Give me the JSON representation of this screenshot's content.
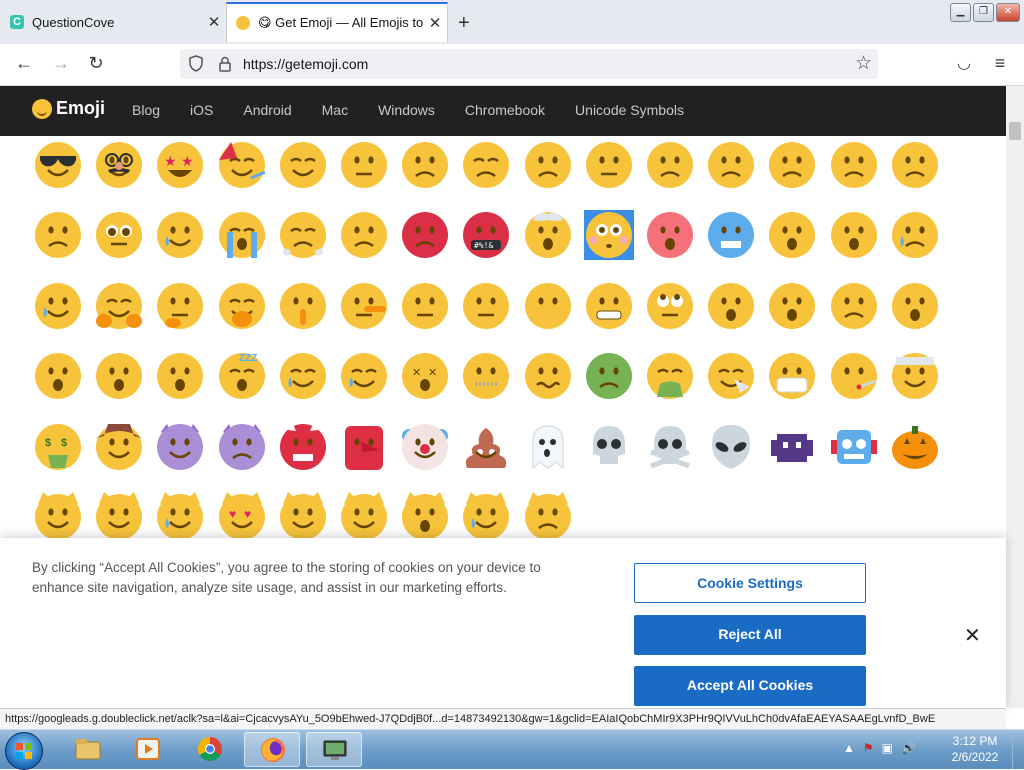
{
  "browser": {
    "tabs": [
      {
        "title": "QuestionCove",
        "active": false
      },
      {
        "title": "😋 Get Emoji — All Emojis to ✂️",
        "active": true
      }
    ],
    "url": "https://getemoji.com"
  },
  "site": {
    "brand": "Emoji",
    "nav": [
      "Blog",
      "iOS",
      "Android",
      "Mac",
      "Windows",
      "Chromebook",
      "Unicode Symbols"
    ]
  },
  "emoji_grid": {
    "selected_row": 1,
    "selected_col": 9,
    "rows": [
      [
        "sunglasses-face",
        "disguised-face",
        "star-struck",
        "partying-face",
        "smirking-face",
        "unamused-face",
        "disappointed-face",
        "pensive-face",
        "worried-face",
        "confused-face",
        "slightly-frowning-face",
        "frowning-face",
        "persevering-face",
        "confounded-face",
        "tired-face"
      ],
      [
        "weary-face",
        "pleading-face",
        "crying-face",
        "loudly-crying-face",
        "face-with-steam",
        "angry-face",
        "pouting-face",
        "face-with-symbols",
        "exploding-head",
        "flushed-face",
        "hot-face",
        "cold-face",
        "screaming-face",
        "anxious-face",
        "sad-sweat-face"
      ],
      [
        "downcast-sweat-face",
        "hugging-face",
        "thinking-face",
        "face-hand-over-mouth",
        "shushing-face",
        "lying-face",
        "neutral-face",
        "expressionless-face",
        "no-mouth-face",
        "grimacing-face",
        "rolling-eyes-face",
        "hushed-face",
        "frowning-open-mouth",
        "anguished-face",
        "fearful-face"
      ],
      [
        "open-mouth-face",
        "astonished-face",
        "yawning-face",
        "sleeping-face",
        "drooling-face",
        "sleepy-face",
        "dizzy-face",
        "zipper-mouth-face",
        "woozy-face",
        "nauseated-face",
        "vomiting-face",
        "sneezing-face",
        "mask-face",
        "thermometer-face",
        "bandage-face"
      ],
      [
        "money-mouth-face",
        "cowboy-face",
        "smiling-devil",
        "angry-devil",
        "ogre",
        "goblin",
        "clown-face",
        "pile-of-poo",
        "ghost",
        "skull",
        "skull-crossbones",
        "alien",
        "alien-monster",
        "robot",
        "jack-o-lantern"
      ],
      [
        "grinning-cat",
        "grinning-cat-smiling-eyes",
        "cat-tears-of-joy",
        "heart-eyes-cat",
        "wry-smile-cat",
        "kissing-cat",
        "weary-cat",
        "crying-cat",
        "pouting-cat"
      ]
    ]
  },
  "cookie_banner": {
    "text": "By clicking “Accept All Cookies”, you agree to the storing of cookies on your device to enhance site navigation, analyze site usage, and assist in our marketing efforts.",
    "settings_label": "Cookie Settings",
    "reject_label": "Reject All",
    "accept_label": "Accept All Cookies",
    "close_label": "✕"
  },
  "status_bar": {
    "text": "https://googleads.g.doubleclick.net/aclk?sa=l&ai=CjcacvysAYu_5O9bEhwed-J7QDdjB0f...d=14873492130&gw=1&gclid=EAIaIQobChMIr9X3PHr9QIVVuLhCh0dvAfaEAEYASAAEgLvnfD_BwE"
  },
  "taskbar": {
    "time": "3:12 PM",
    "date": "2/6/2022"
  },
  "colors": {
    "emoji_yellow": "#f7c33a",
    "site_header": "#212121",
    "button_blue": "#1a6bc4",
    "selection_blue": "#3b8de5"
  }
}
